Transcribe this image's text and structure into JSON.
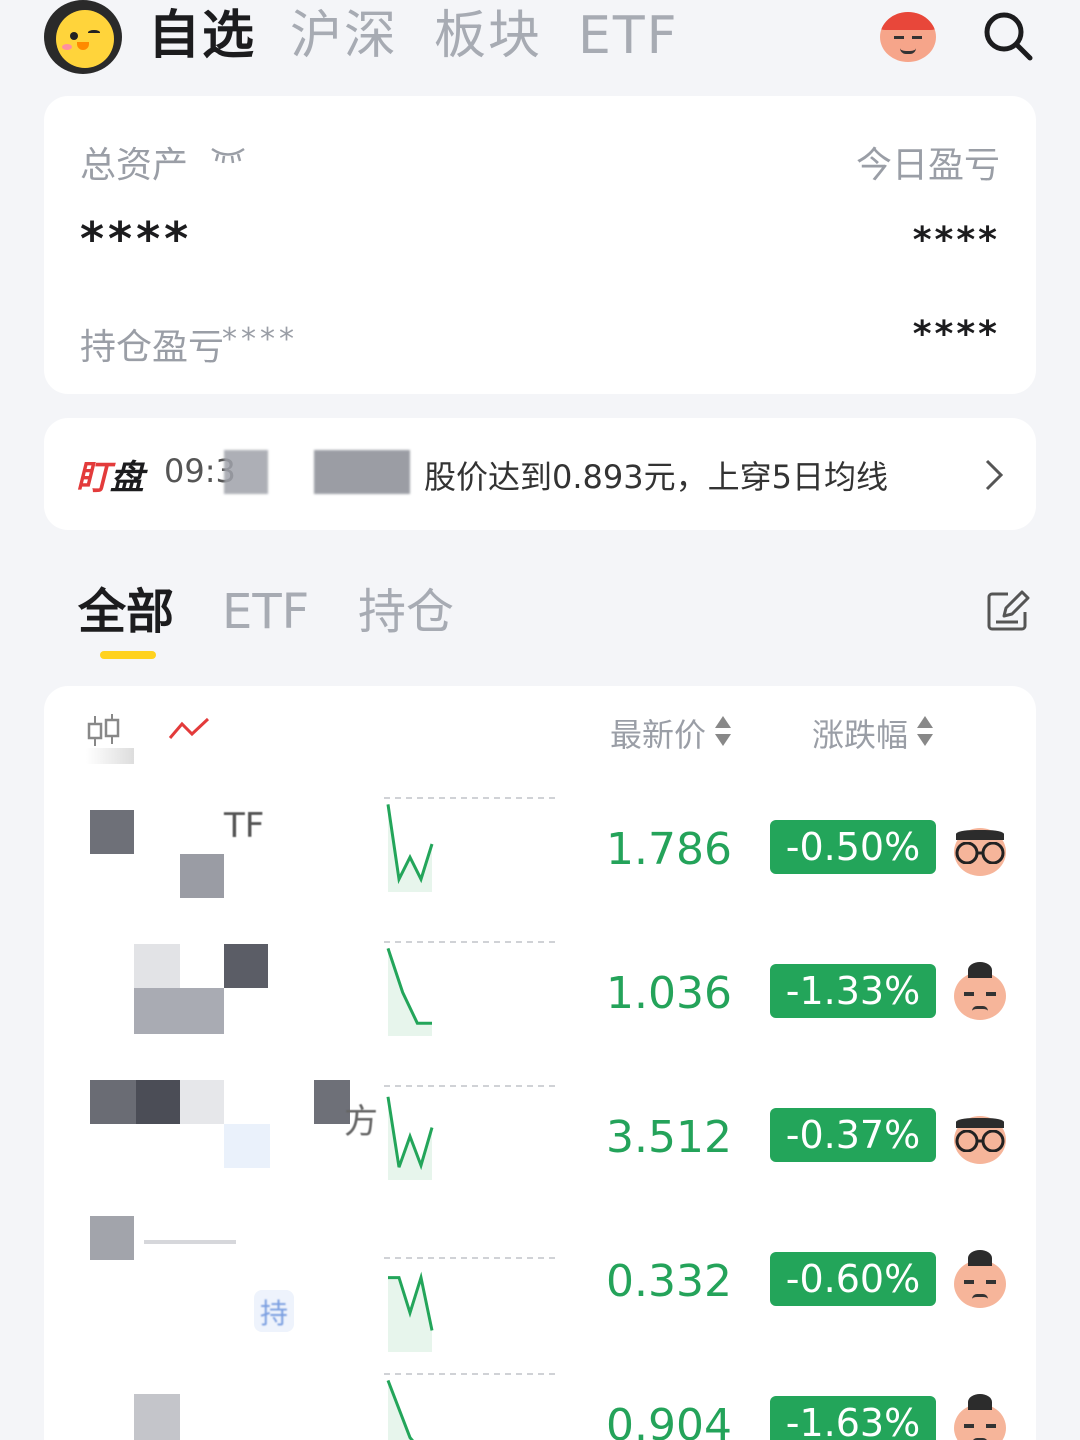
{
  "nav": {
    "tabs": [
      {
        "label": "自选",
        "active": true
      },
      {
        "label": "沪深",
        "active": false
      },
      {
        "label": "板块",
        "active": false
      },
      {
        "label": "ETF",
        "active": false
      }
    ],
    "logo_icon": "duck-logo-icon",
    "profile_icon": "red-hair-avatar-icon",
    "search_icon": "search-icon"
  },
  "assets": {
    "total_label": "总资产",
    "total_value": "****",
    "today_pl_label": "今日盈亏",
    "today_pl_value": "****",
    "holding_pl_label": "持仓盈亏",
    "holding_pl_value": "****",
    "holding_pl_right_value": "****",
    "hide_icon": "eye-closed-icon"
  },
  "alert": {
    "tag_part1": "盯",
    "tag_part2": "盘",
    "time": "09:3",
    "message": "股价达到0.893元，上穿5日均线",
    "chevron_icon": "chevron-right-icon"
  },
  "watch_tabs": [
    {
      "label": "全部",
      "active": true
    },
    {
      "label": "ETF",
      "active": false
    },
    {
      "label": "持仓",
      "active": false
    }
  ],
  "list_header": {
    "price_label": "最新价",
    "change_label": "涨跌幅"
  },
  "colors": {
    "down_green": "#23a55a",
    "accent_yellow": "#ffd21f",
    "alert_red": "#e33b3b"
  },
  "rows": [
    {
      "name_fragment": "TF",
      "price": "1.786",
      "change": "-0.50%",
      "avatar": "glasses-face-icon",
      "spark": [
        0.05,
        0.9,
        0.65,
        0.9,
        0.5
      ]
    },
    {
      "name_fragment": "",
      "price": "1.036",
      "change": "-1.33%",
      "avatar": "bun-face-icon",
      "spark": [
        0.05,
        0.55,
        0.9,
        0.9
      ]
    },
    {
      "name_fragment": "方",
      "price": "3.512",
      "change": "-0.37%",
      "avatar": "glasses-face-icon",
      "spark": [
        0.1,
        0.9,
        0.55,
        0.88,
        0.45
      ]
    },
    {
      "name_fragment": "持",
      "price": "0.332",
      "change": "-0.60%",
      "avatar": "bun-face-icon",
      "spark": [
        0.2,
        0.2,
        0.6,
        0.2,
        0.8
      ]
    },
    {
      "name_fragment": "",
      "price": "0.904",
      "change": "-1.63%",
      "avatar": "bun-face-icon",
      "spark": [
        0.05,
        0.7,
        1.0
      ]
    }
  ]
}
